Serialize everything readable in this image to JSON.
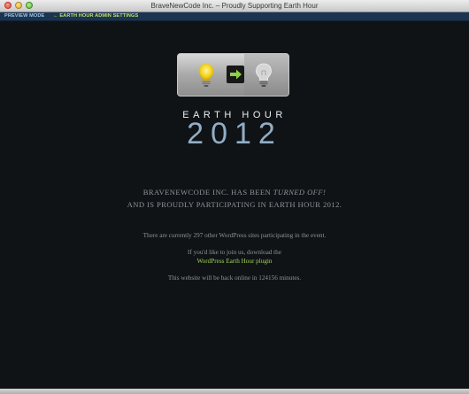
{
  "window": {
    "title": "BraveNewCode Inc. – Proudly Supporting Earth Hour"
  },
  "adminbar": {
    "preview_label": "PREVIEW MODE",
    "settings_link": "← EARTH HOUR ADMIN SETTINGS"
  },
  "icons": [
    "lightbulb-on-icon",
    "arrow-right-icon",
    "lightbulb-off-icon"
  ],
  "colors": {
    "background": "#101315",
    "accent": "#92aec6",
    "link": "#9fd05a",
    "adminbar": "#1c3450"
  },
  "hero": {
    "label": "EARTH HOUR",
    "year": "2012"
  },
  "message": {
    "line1_prefix": "BRAVENEWCODE INC. HAS BEEN ",
    "line1_emphasis": "TURNED OFF!",
    "line2": "AND IS PROUDLY PARTICIPATING IN EARTH HOUR 2012.",
    "count_text": "There are currently 297 other WordPress sites participating in the event.",
    "join_text": "If you'd like to join us, download the",
    "plugin_link": "WordPress Earth Hour plugin",
    "back_online": "This website will be back online in 124156 minutes."
  }
}
